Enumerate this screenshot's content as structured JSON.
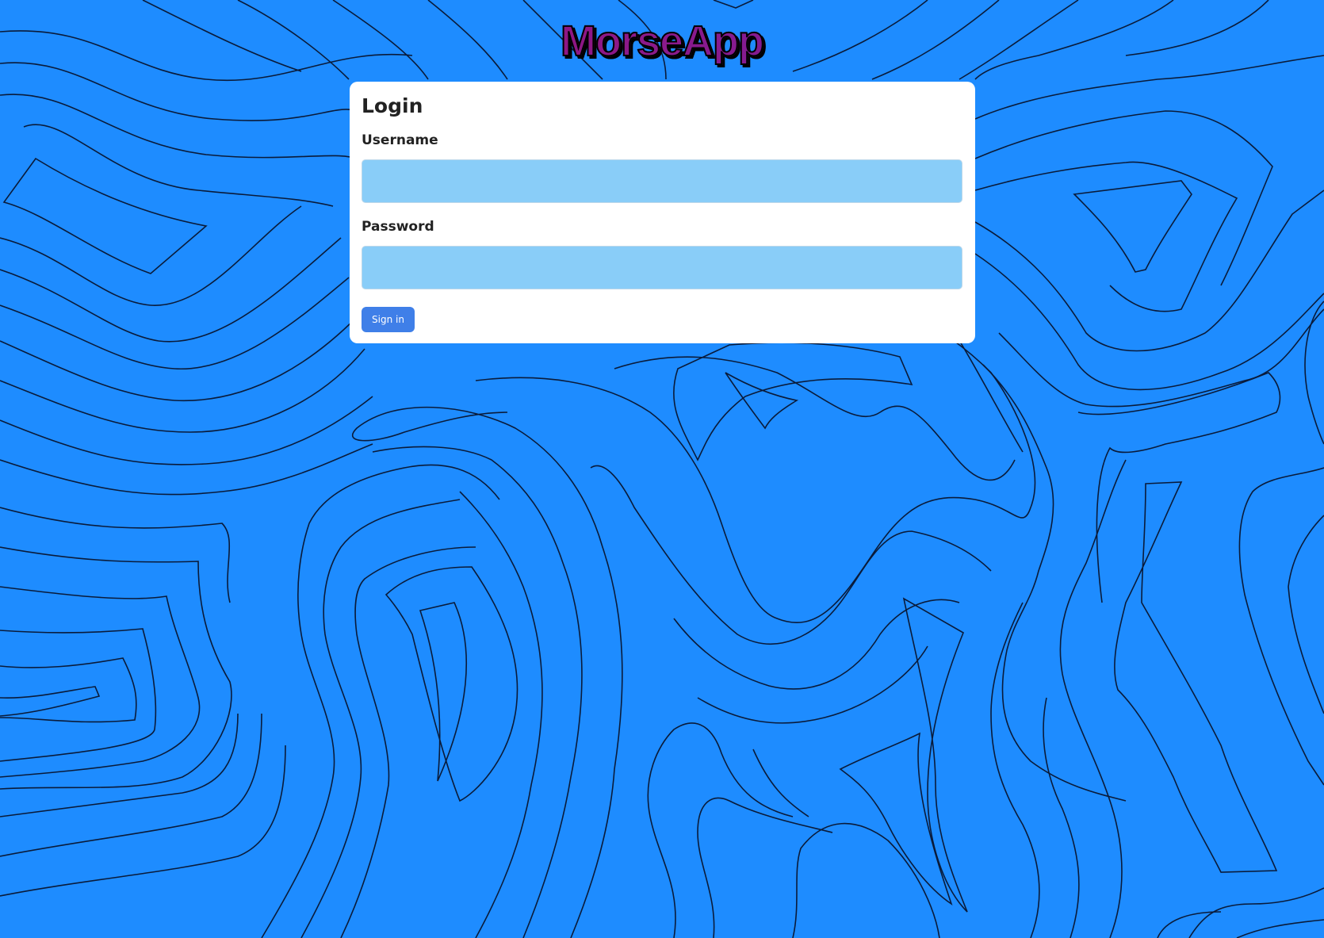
{
  "app": {
    "logo_text": "MorseApp"
  },
  "login": {
    "title": "Login",
    "username_label": "Username",
    "username_value": "",
    "password_label": "Password",
    "password_value": "",
    "submit_label": "Sign in"
  },
  "colors": {
    "background": "#1e8cff",
    "contour_lines": "#0a1b3a",
    "input_fill": "#89cdf8",
    "button": "#3f7fe8",
    "logo_gradient": [
      "#a0005a",
      "#8b1a8b",
      "#5a20b0"
    ]
  }
}
